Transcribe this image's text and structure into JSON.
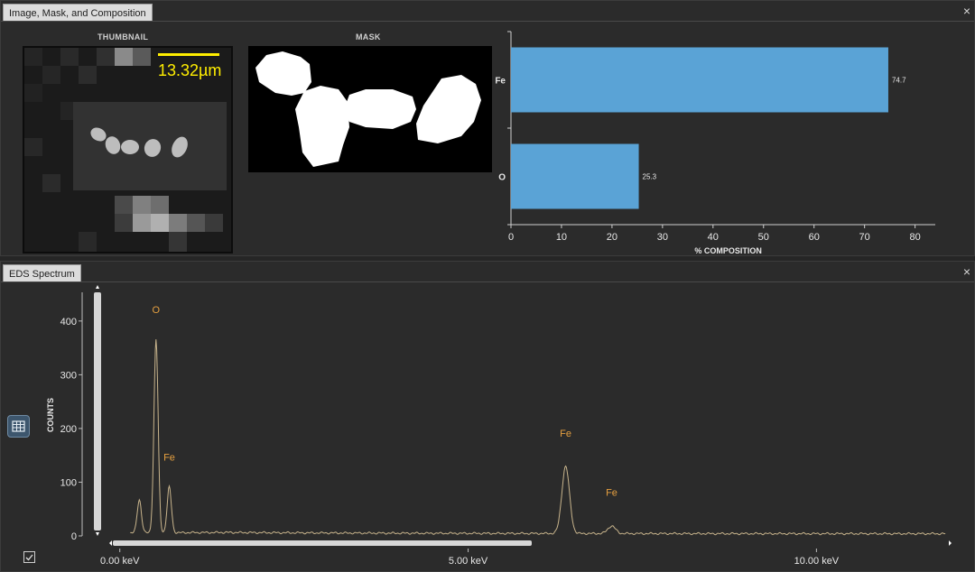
{
  "top_panel": {
    "tab_title": "Image, Mask, and Composition",
    "close_glyph": "×",
    "thumbnail_title": "THUMBNAIL",
    "mask_title": "MASK",
    "scale_label": "13.32µm"
  },
  "composition_chart": {
    "chart_data": {
      "type": "bar",
      "orientation": "horizontal",
      "categories": [
        "Fe",
        "O"
      ],
      "values": [
        74.7,
        25.3
      ],
      "value_labels": [
        "74.7",
        "25.3"
      ],
      "xlabel": "% COMPOSITION",
      "xlim": [
        0,
        84
      ],
      "xticks": [
        0,
        10,
        20,
        30,
        40,
        50,
        60,
        70,
        80
      ],
      "bar_color": "#5aa3d6"
    }
  },
  "bottom_panel": {
    "tab_title": "EDS Spectrum",
    "close_glyph": "×"
  },
  "spectrum_chart": {
    "chart_data": {
      "type": "line",
      "ylabel": "COUNTS",
      "ylim": [
        0,
        440
      ],
      "yticks": [
        0,
        100,
        200,
        300,
        400
      ],
      "xlim_kev": [
        -0.1,
        11.9
      ],
      "xtick_labels": [
        {
          "kev": 0,
          "label": "0.00 keV"
        },
        {
          "kev": 5,
          "label": "5.00 keV"
        },
        {
          "kev": 10,
          "label": "10.00 keV"
        }
      ],
      "peaks": [
        {
          "kev": 0.28,
          "counts": 62
        },
        {
          "kev": 0.52,
          "counts": 360
        },
        {
          "kev": 0.71,
          "counts": 85
        },
        {
          "kev": 6.4,
          "counts": 125
        },
        {
          "kev": 7.06,
          "counts": 14
        }
      ],
      "annotations": [
        {
          "text": "O",
          "kev": 0.52,
          "counts": 415
        },
        {
          "text": "Fe",
          "kev": 0.71,
          "counts": 140
        },
        {
          "text": "Fe",
          "kev": 6.4,
          "counts": 185
        },
        {
          "text": "Fe",
          "kev": 7.06,
          "counts": 75
        }
      ],
      "line_color": "#c8b48c",
      "annotation_color": "#e6a040"
    }
  }
}
